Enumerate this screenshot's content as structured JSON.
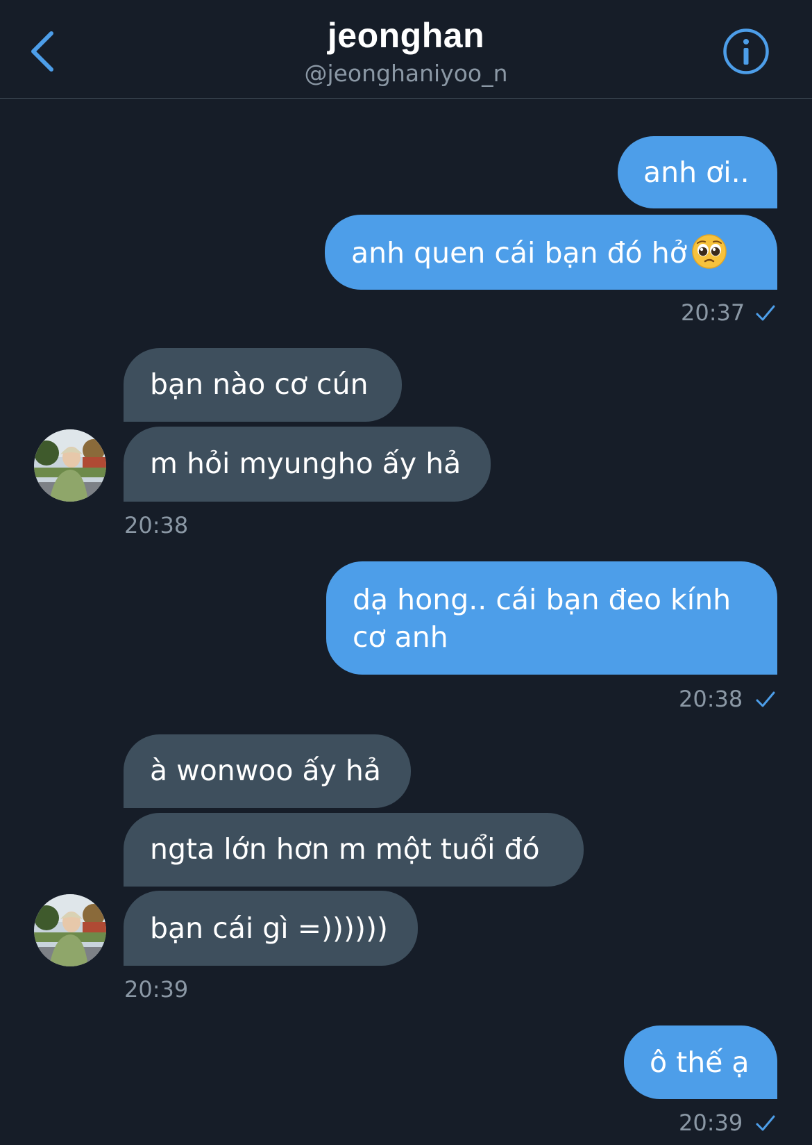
{
  "header": {
    "name": "jeonghan",
    "handle": "@jeonghaniyoo_n"
  },
  "colors": {
    "background": "#161d28",
    "outgoing_bubble": "#4d9ee9",
    "incoming_bubble": "#3e4f5d",
    "accent": "#4d9ee9",
    "secondary_text": "#8b98a5"
  },
  "messages": [
    {
      "direction": "outgoing",
      "text": "anh ơi.."
    },
    {
      "direction": "outgoing",
      "text": "anh quen cái bạn đó hở",
      "emoji": "pleading-face"
    },
    {
      "direction": "outgoing",
      "time": "20:37",
      "read": true
    },
    {
      "direction": "incoming",
      "text": "bạn nào cơ cún"
    },
    {
      "direction": "incoming",
      "text": "m hỏi myungho ấy hả"
    },
    {
      "direction": "incoming",
      "time": "20:38"
    },
    {
      "direction": "outgoing",
      "lines": [
        "dạ hong.. cái bạn đeo kính",
        "cơ anh"
      ]
    },
    {
      "direction": "outgoing",
      "time": "20:38",
      "read": true
    },
    {
      "direction": "incoming",
      "text": "à wonwoo ấy hả"
    },
    {
      "direction": "incoming",
      "text": "ngta lớn hơn m một tuổi đó"
    },
    {
      "direction": "incoming",
      "text": "bạn cái gì =))))))"
    },
    {
      "direction": "incoming",
      "time": "20:39"
    },
    {
      "direction": "outgoing",
      "text": "ô thế ạ"
    },
    {
      "direction": "outgoing",
      "time": "20:39",
      "read": true
    }
  ]
}
